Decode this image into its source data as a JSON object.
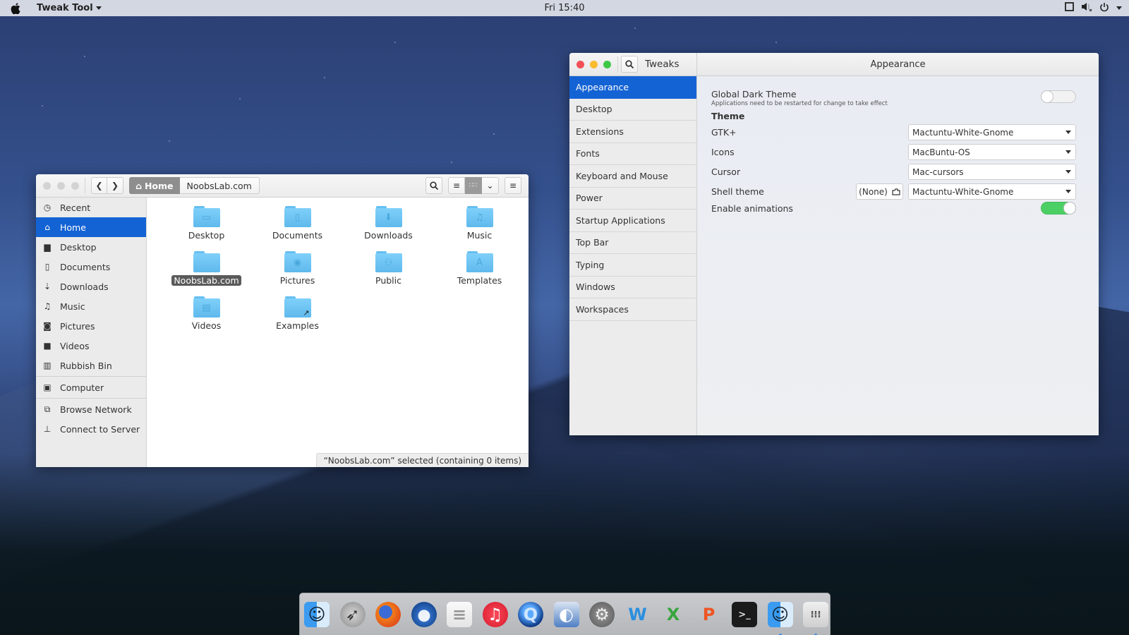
{
  "topbar": {
    "app_menu": "Tweak Tool",
    "clock": "Fri 15:40",
    "tray_icons": [
      "window-icon",
      "volume-muted-icon",
      "power-icon"
    ]
  },
  "files": {
    "breadcrumb": {
      "home": "Home",
      "current": "NoobsLab.com"
    },
    "sidebar": [
      {
        "label": "Recent",
        "icon": "clock-icon"
      },
      {
        "label": "Home",
        "icon": "home-icon",
        "active": true
      },
      {
        "label": "Desktop",
        "icon": "desktop-folder-icon"
      },
      {
        "label": "Documents",
        "icon": "document-icon"
      },
      {
        "label": "Downloads",
        "icon": "download-icon"
      },
      {
        "label": "Music",
        "icon": "music-icon"
      },
      {
        "label": "Pictures",
        "icon": "camera-icon"
      },
      {
        "label": "Videos",
        "icon": "video-icon"
      },
      {
        "label": "Rubbish Bin",
        "icon": "trash-icon"
      },
      {
        "label": "Computer",
        "icon": "computer-icon"
      },
      {
        "label": "Browse Network",
        "icon": "network-icon"
      },
      {
        "label": "Connect to Server",
        "icon": "server-icon"
      }
    ],
    "items": [
      {
        "name": "Desktop",
        "emblem": "▭"
      },
      {
        "name": "Documents",
        "emblem": "▯"
      },
      {
        "name": "Downloads",
        "emblem": "⬇"
      },
      {
        "name": "Music",
        "emblem": "♫"
      },
      {
        "name": "NoobsLab.com",
        "emblem": "",
        "selected": true
      },
      {
        "name": "Pictures",
        "emblem": "◉"
      },
      {
        "name": "Public",
        "emblem": "⚇"
      },
      {
        "name": "Templates",
        "emblem": "A"
      },
      {
        "name": "Videos",
        "emblem": "▤"
      },
      {
        "name": "Examples",
        "emblem": "↗"
      }
    ],
    "status": "“NoobsLab.com” selected  (containing 0 items)"
  },
  "tweaks": {
    "title": "Tweaks",
    "page_title": "Appearance",
    "sidebar": [
      "Appearance",
      "Desktop",
      "Extensions",
      "Fonts",
      "Keyboard and Mouse",
      "Power",
      "Startup Applications",
      "Top Bar",
      "Typing",
      "Windows",
      "Workspaces"
    ],
    "active_index": 0,
    "global_dark": {
      "label": "Global Dark Theme",
      "hint": "Applications need to be restarted for change to take effect",
      "enabled": false
    },
    "theme_section": "Theme",
    "gtk": {
      "label": "GTK+",
      "value": "Mactuntu-White-Gnome"
    },
    "icons": {
      "label": "Icons",
      "value": "MacBuntu-OS"
    },
    "cursor": {
      "label": "Cursor",
      "value": "Mac-cursors"
    },
    "shell": {
      "label": "Shell theme",
      "none_label": "(None)",
      "value": "Mactuntu-White-Gnome"
    },
    "animations": {
      "label": "Enable animations",
      "enabled": true
    }
  },
  "dock": {
    "items": [
      "Finder",
      "Launchpad",
      "Firefox",
      "Thunderbird",
      "Text Editor",
      "iTunes",
      "QuickTime",
      "Preview",
      "System Preferences",
      "Word",
      "Excel",
      "PowerPoint",
      "Terminal",
      "Files",
      "Switcher"
    ]
  }
}
